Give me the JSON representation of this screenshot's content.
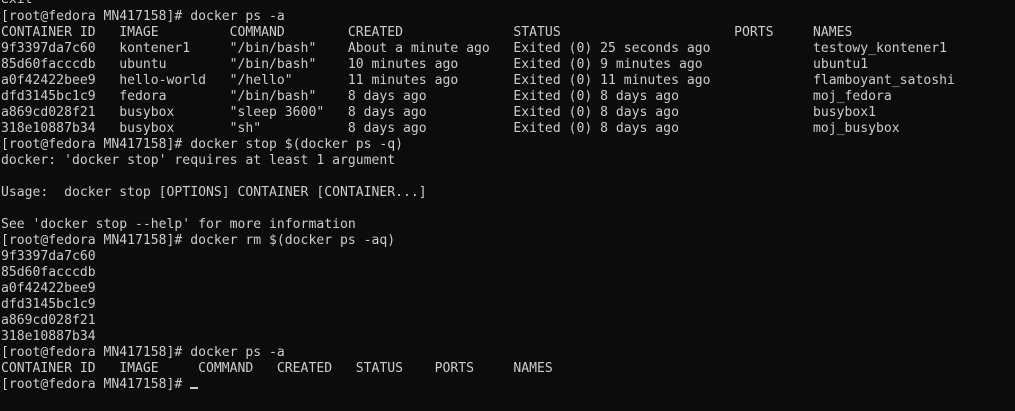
{
  "colors": {
    "background": "#0c0c0c",
    "foreground": "#cccccc"
  },
  "terminal": {
    "lines": [
      "exit",
      "[root@fedora MN417158]# docker ps -a",
      "CONTAINER ID   IMAGE         COMMAND        CREATED              STATUS                      PORTS     NAMES",
      "9f3397da7c60   kontener1     \"/bin/bash\"    About a minute ago   Exited (0) 25 seconds ago             testowy_kontener1",
      "85d60facccdb   ubuntu        \"/bin/bash\"    10 minutes ago       Exited (0) 9 minutes ago              ubuntu1",
      "a0f42422bee9   hello-world   \"/hello\"       11 minutes ago       Exited (0) 11 minutes ago             flamboyant_satoshi",
      "dfd3145bc1c9   fedora        \"/bin/bash\"    8 days ago           Exited (0) 8 days ago                 moj_fedora",
      "a869cd028f21   busybox       \"sleep 3600\"   8 days ago           Exited (0) 8 days ago                 busybox1",
      "318e10887b34   busybox       \"sh\"           8 days ago           Exited (0) 8 days ago                 moj_busybox",
      "[root@fedora MN417158]# docker stop $(docker ps -q)",
      "docker: 'docker stop' requires at least 1 argument",
      "",
      "Usage:  docker stop [OPTIONS] CONTAINER [CONTAINER...]",
      "",
      "See 'docker stop --help' for more information",
      "[root@fedora MN417158]# docker rm $(docker ps -aq)",
      "9f3397da7c60",
      "85d60facccdb",
      "a0f42422bee9",
      "dfd3145bc1c9",
      "a869cd028f21",
      "318e10887b34",
      "[root@fedora MN417158]# docker ps -a",
      "CONTAINER ID   IMAGE     COMMAND   CREATED   STATUS    PORTS     NAMES",
      "[root@fedora MN417158]#"
    ]
  }
}
